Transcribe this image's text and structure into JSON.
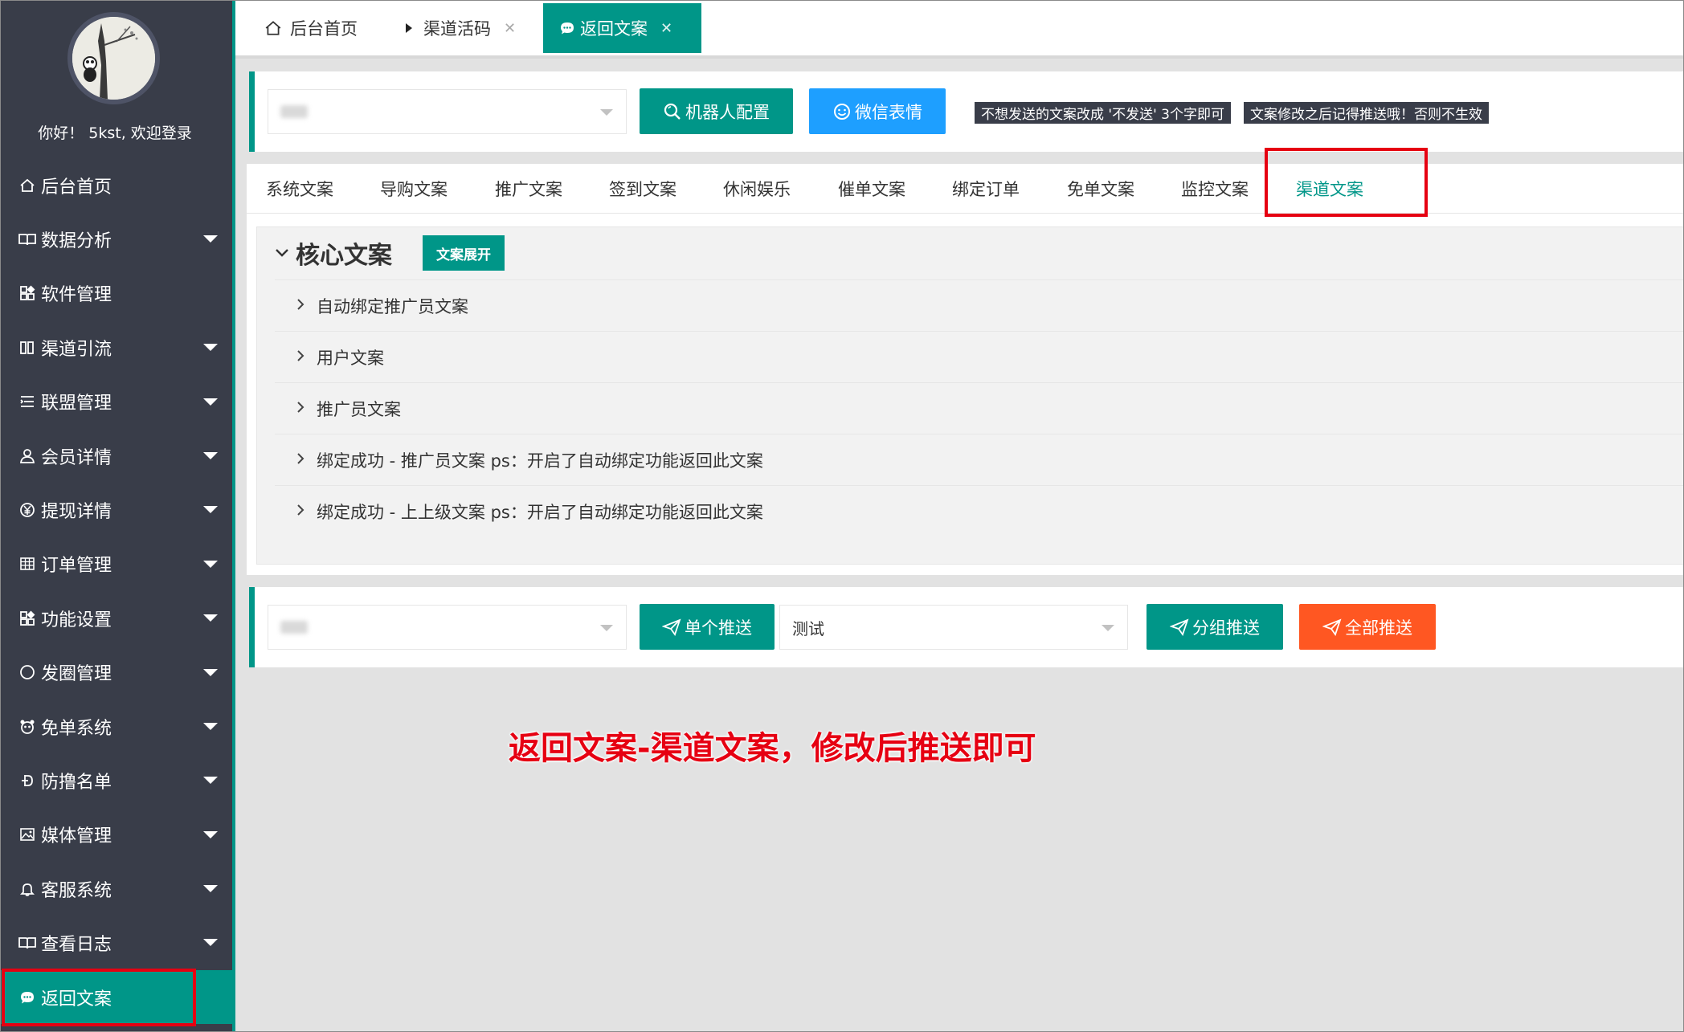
{
  "sidebar": {
    "welcome": "你好！ 5kst, 欢迎登录",
    "items": [
      {
        "label": "后台首页",
        "icon": "home-icon"
      },
      {
        "label": "数据分析",
        "icon": "book-icon"
      },
      {
        "label": "软件管理",
        "icon": "apps-icon"
      },
      {
        "label": "渠道引流",
        "icon": "columns-icon"
      },
      {
        "label": "联盟管理",
        "icon": "list-icon"
      },
      {
        "label": "会员详情",
        "icon": "user-icon"
      },
      {
        "label": "提现详情",
        "icon": "yen-icon"
      },
      {
        "label": "订单管理",
        "icon": "table-icon"
      },
      {
        "label": "功能设置",
        "icon": "apps-icon"
      },
      {
        "label": "发圈管理",
        "icon": "circle-icon"
      },
      {
        "label": "免单系统",
        "icon": "panda-icon"
      },
      {
        "label": "防撸名单",
        "icon": "dollar-icon"
      },
      {
        "label": "媒体管理",
        "icon": "image-icon"
      },
      {
        "label": "客服系统",
        "icon": "bell-icon"
      },
      {
        "label": "查看日志",
        "icon": "book-icon"
      },
      {
        "label": "返回文案",
        "icon": "chat-icon"
      }
    ]
  },
  "tabs": [
    {
      "label": "后台首页"
    },
    {
      "label": "渠道活码"
    },
    {
      "label": "返回文案"
    }
  ],
  "toolbar": {
    "robot_config": "机器人配置",
    "wechat_emoji": "微信表情",
    "note1": "不想发送的文案改成 '不发送' 3个字即可",
    "note2": "文案修改之后记得推送哦！否则不生效"
  },
  "subtabs": [
    "系统文案",
    "导购文案",
    "推广文案",
    "签到文案",
    "休闲娱乐",
    "催单文案",
    "绑定订单",
    "免单文案",
    "监控文案",
    "渠道文案"
  ],
  "core": {
    "title": "核心文案",
    "expand": "文案展开",
    "rows": [
      "自动绑定推广员文案",
      "用户文案",
      "推广员文案",
      "绑定成功 - 推广员文案 ps：开启了自动绑定功能返回此文案",
      "绑定成功 - 上上级文案 ps：开启了自动绑定功能返回此文案"
    ]
  },
  "push": {
    "single": "单个推送",
    "group_select": "测试",
    "group": "分组推送",
    "all": "全部推送"
  },
  "annotation": "返回文案-渠道文案，修改后推送即可",
  "colors": {
    "sidebar_bg": "#393d49",
    "accent": "#009688",
    "blue": "#1e9fff",
    "orange": "#ff5722",
    "highlight": "#e60012"
  }
}
